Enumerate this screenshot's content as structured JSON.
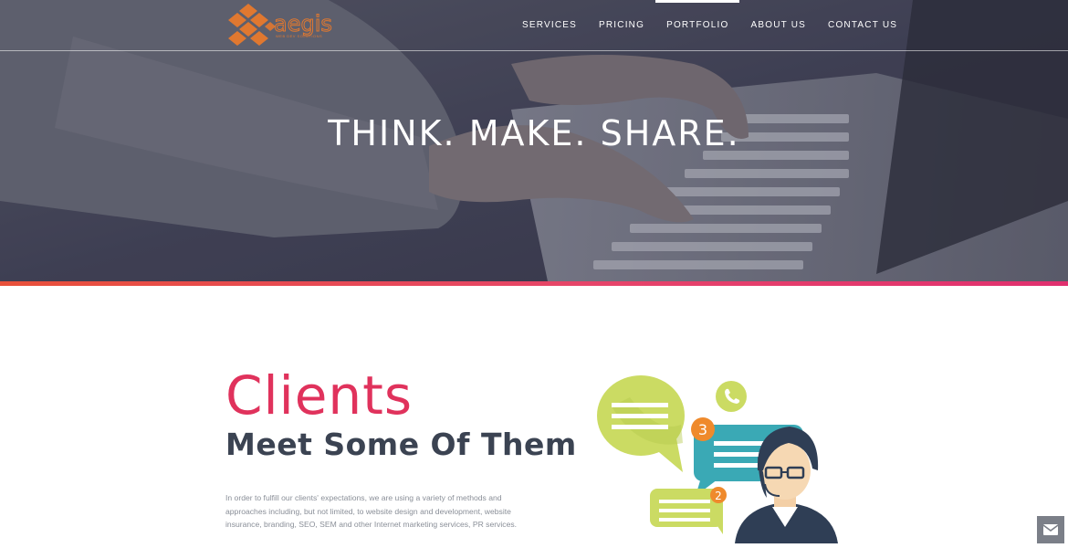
{
  "brand": {
    "logo_text": "aegis",
    "logo_sub": "WEB DEV SOLUTIONS",
    "accent": "#e07830"
  },
  "nav": {
    "items": [
      {
        "label": "SERVICES",
        "active": false
      },
      {
        "label": "PRICING",
        "active": false
      },
      {
        "label": "PORTFOLIO",
        "active": true
      },
      {
        "label": "ABOUT US",
        "active": false
      },
      {
        "label": "CONTACT US",
        "active": false
      }
    ]
  },
  "hero": {
    "title": "THINK. MAKE. SHARE."
  },
  "clients": {
    "title": "Clients",
    "subtitle": "Meet Some Of Them",
    "body": "In order to fulfill our clients' expectations, we are using a variety of methods and approaches including, but not limited, to website design and development, website insurance, branding, SEO, SEM and other Internet marketing services, PR services.",
    "title_color": "#e0325c"
  },
  "illustration": {
    "badge_1": "3",
    "badge_2": "2",
    "icons": [
      "speech-bubble-icon",
      "phone-icon",
      "support-agent-icon"
    ]
  },
  "floating": {
    "icon": "envelope-icon"
  }
}
